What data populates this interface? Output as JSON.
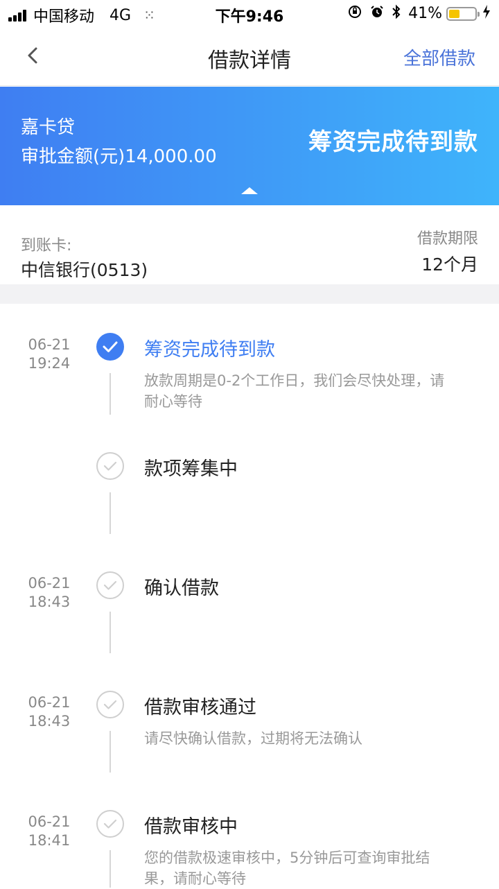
{
  "status_bar": {
    "carrier": "中国移动",
    "network": "4G",
    "time": "下午9:46",
    "battery_percent": "41%",
    "battery_level": 0.41,
    "icons": [
      "signal-icon",
      "loading-icon",
      "rotation-lock-icon",
      "alarm-icon",
      "bluetooth-icon",
      "battery-icon",
      "charging-icon"
    ]
  },
  "nav": {
    "back_icon": "chevron-left-icon",
    "title": "借款详情",
    "action": "全部借款"
  },
  "banner": {
    "product_name": "嘉卡贷",
    "approval_amount": "审批金额(元)14,000.00",
    "status": "筹资完成待到款",
    "gradient": [
      "#3f7ef2",
      "#3fb4fb"
    ]
  },
  "account": {
    "card_label": "到账卡:",
    "card_value": "中信银行(0513)",
    "term_label": "借款期限",
    "term_value": "12个月"
  },
  "colors": {
    "accent": "#3f7ef2",
    "nav_action": "#4a73d9",
    "muted_text": "#999999"
  },
  "timeline": [
    {
      "date": "06-21",
      "time": "19:24",
      "title": "筹资完成待到款",
      "desc": "放款周期是0-2个工作日，我们会尽快处理，请耐心等待",
      "state": "active",
      "icon": "check-circle-filled-icon"
    },
    {
      "date": "",
      "time": "",
      "title": "款项筹集中",
      "desc": "",
      "state": "done",
      "icon": "check-circle-outline-icon"
    },
    {
      "date": "06-21",
      "time": "18:43",
      "title": "确认借款",
      "desc": "",
      "state": "done",
      "icon": "check-circle-outline-icon"
    },
    {
      "date": "06-21",
      "time": "18:43",
      "title": "借款审核通过",
      "desc": "请尽快确认借款，过期将无法确认",
      "state": "done",
      "icon": "check-circle-outline-icon"
    },
    {
      "date": "06-21",
      "time": "18:41",
      "title": "借款审核中",
      "desc": "您的借款极速审核中，5分钟后可查询审批结果，请耐心等待",
      "state": "done",
      "icon": "check-circle-outline-icon"
    }
  ]
}
